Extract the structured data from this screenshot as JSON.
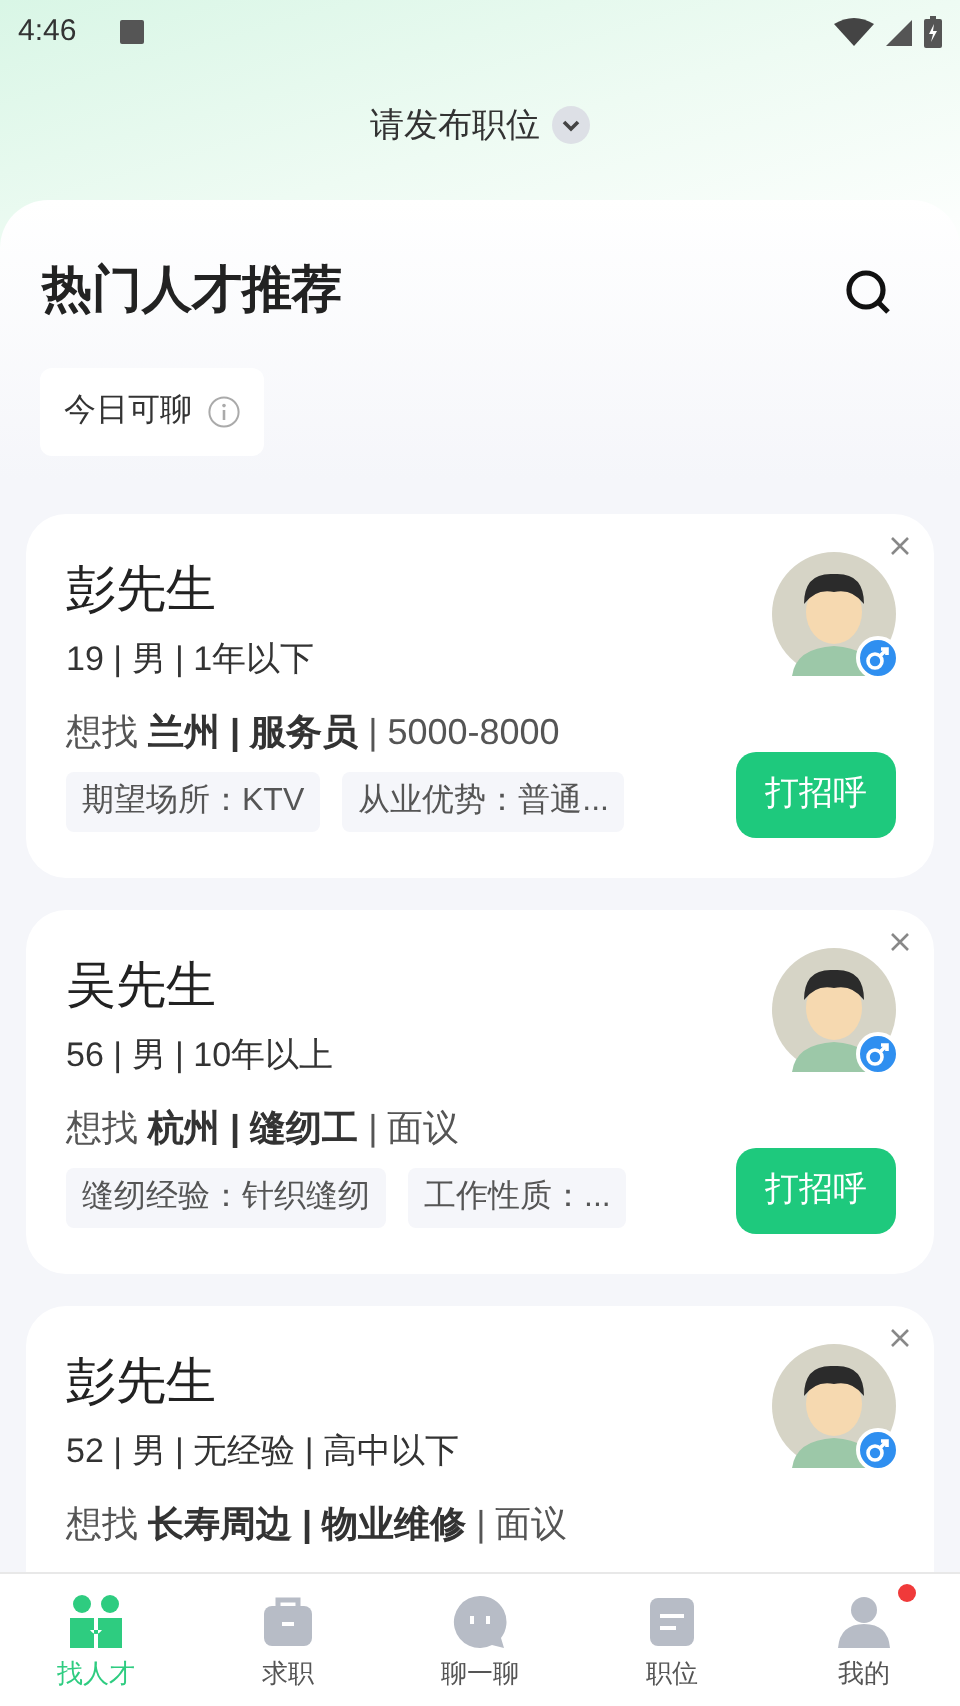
{
  "status_bar": {
    "time": "4:46"
  },
  "header": {
    "title": "请发布职位"
  },
  "section": {
    "title": "热门人才推荐",
    "filter": "今日可聊"
  },
  "candidates": [
    {
      "name": "彭先生",
      "info": "19 | 男 | 1年以下",
      "want_prefix": "想找",
      "want_place": "兰州 | 服务员",
      "want_salary": "| 5000-8000",
      "tags": [
        "期望场所：KTV",
        "从业优势：普通..."
      ],
      "button": "打招呼"
    },
    {
      "name": "吴先生",
      "info": "56 | 男 | 10年以上",
      "want_prefix": "想找",
      "want_place": "杭州 | 缝纫工",
      "want_salary": "| 面议",
      "tags": [
        "缝纫经验：针织缝纫",
        "工作性质：..."
      ],
      "button": "打招呼"
    },
    {
      "name": "彭先生",
      "info": "52 | 男 | 无经验 | 高中以下",
      "want_prefix": "想找",
      "want_place": "长寿周边 | 物业维修",
      "want_salary": "| 面议"
    }
  ],
  "tabs": [
    {
      "label": "找人才",
      "selected": true,
      "kind": "people",
      "badge": false
    },
    {
      "label": "求职",
      "selected": false,
      "kind": "briefcase",
      "badge": false
    },
    {
      "label": "聊一聊",
      "selected": false,
      "kind": "chat",
      "badge": false
    },
    {
      "label": "职位",
      "selected": false,
      "kind": "list",
      "badge": false
    },
    {
      "label": "我的",
      "selected": false,
      "kind": "user",
      "badge": true
    }
  ]
}
